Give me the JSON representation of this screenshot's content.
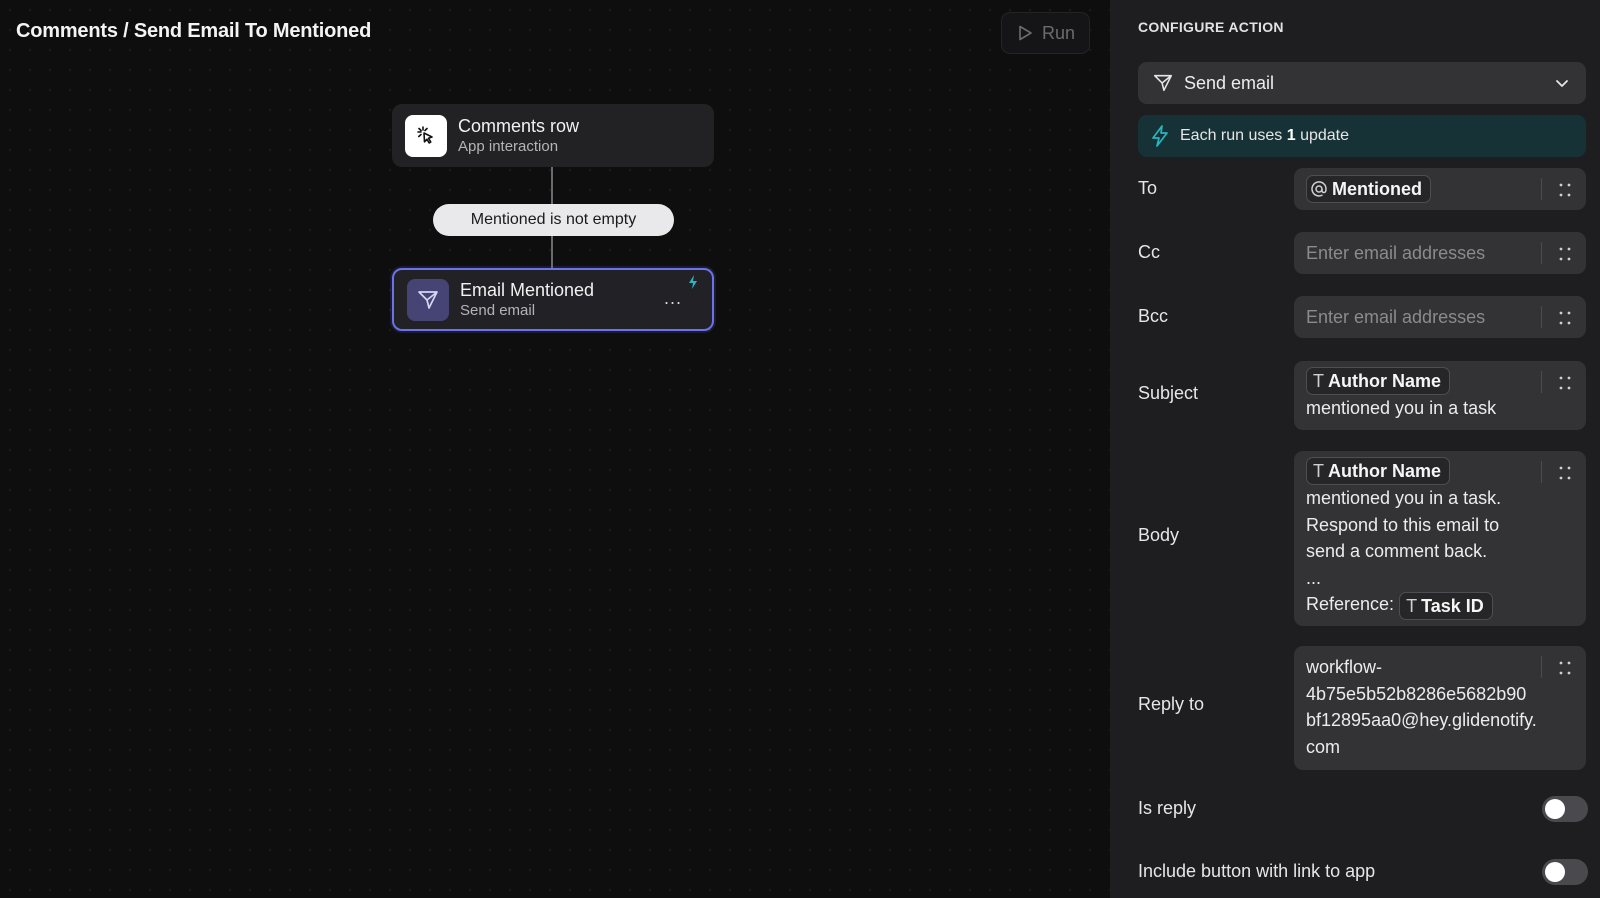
{
  "header": {
    "breadcrumb": "Comments / Send Email To Mentioned",
    "run_label": "Run"
  },
  "workflow": {
    "trigger": {
      "title": "Comments row",
      "subtitle": "App interaction",
      "icon": "pointer-click-icon"
    },
    "condition": "Mentioned is not empty",
    "action": {
      "title": "Email Mentioned",
      "subtitle": "Send email",
      "icon": "send-icon",
      "more": "...",
      "selected": true
    }
  },
  "panel": {
    "title": "CONFIGURE ACTION",
    "action_type": "Send email",
    "usage": {
      "prefix": "Each run uses ",
      "count": "1",
      "suffix": " update"
    },
    "fields": {
      "to": {
        "label": "To",
        "chip": "Mentioned"
      },
      "cc": {
        "label": "Cc",
        "placeholder": "Enter email addresses"
      },
      "bcc": {
        "label": "Bcc",
        "placeholder": "Enter email addresses"
      },
      "subject": {
        "label": "Subject",
        "chip": "Author Name",
        "text": "mentioned you in a task"
      },
      "body": {
        "label": "Body",
        "chip": "Author Name",
        "lines": [
          "mentioned you in a task.",
          "Respond to this email to",
          "send a comment back.",
          "..."
        ],
        "reference_label": "Reference:",
        "reference_chip": "Task ID"
      },
      "reply_to": {
        "label": "Reply to",
        "lines": [
          "workflow-",
          "4b75e5b52b8286e5682b90",
          "bf12895aa0@hey.glidenotify.",
          "com"
        ]
      }
    },
    "toggles": {
      "is_reply": {
        "label": "Is reply",
        "on": false
      },
      "include_button": {
        "label": "Include button with link to app",
        "on": false
      }
    }
  },
  "colors": {
    "canvas_bg": "#0e0e0f",
    "panel_bg": "#1e1e20",
    "field_bg": "#333336",
    "selected_border": "#6c72e8",
    "usage_bg": "#163236",
    "accent_teal": "#2bb4c0"
  }
}
